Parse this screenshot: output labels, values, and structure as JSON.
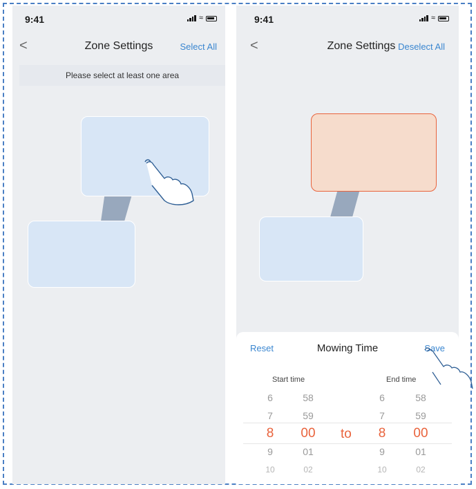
{
  "status_bar": {
    "time": "9:41"
  },
  "screen1": {
    "nav": {
      "back": "<",
      "title": "Zone Settings",
      "action": "Select All"
    },
    "hint": "Please select at least one area"
  },
  "screen2": {
    "nav": {
      "back": "<",
      "title": "Zone Settings",
      "action": "Deselect All"
    },
    "sheet": {
      "reset": "Reset",
      "title": "Mowing Time",
      "save": "Save",
      "start_label": "Start time",
      "end_label": "End time",
      "to": "to",
      "start_hours": [
        "6",
        "7",
        "8",
        "9",
        "10"
      ],
      "start_minutes": [
        "58",
        "59",
        "00",
        "01",
        "02"
      ],
      "end_hours": [
        "6",
        "7",
        "8",
        "9",
        "10"
      ],
      "end_minutes": [
        "58",
        "59",
        "00",
        "01",
        "02"
      ]
    }
  },
  "colors": {
    "accent_blue": "#3a86d0",
    "selected_orange": "#e9633c",
    "zone_fill": "#d8e6f6",
    "zone_selected_fill": "#f6dccc"
  }
}
